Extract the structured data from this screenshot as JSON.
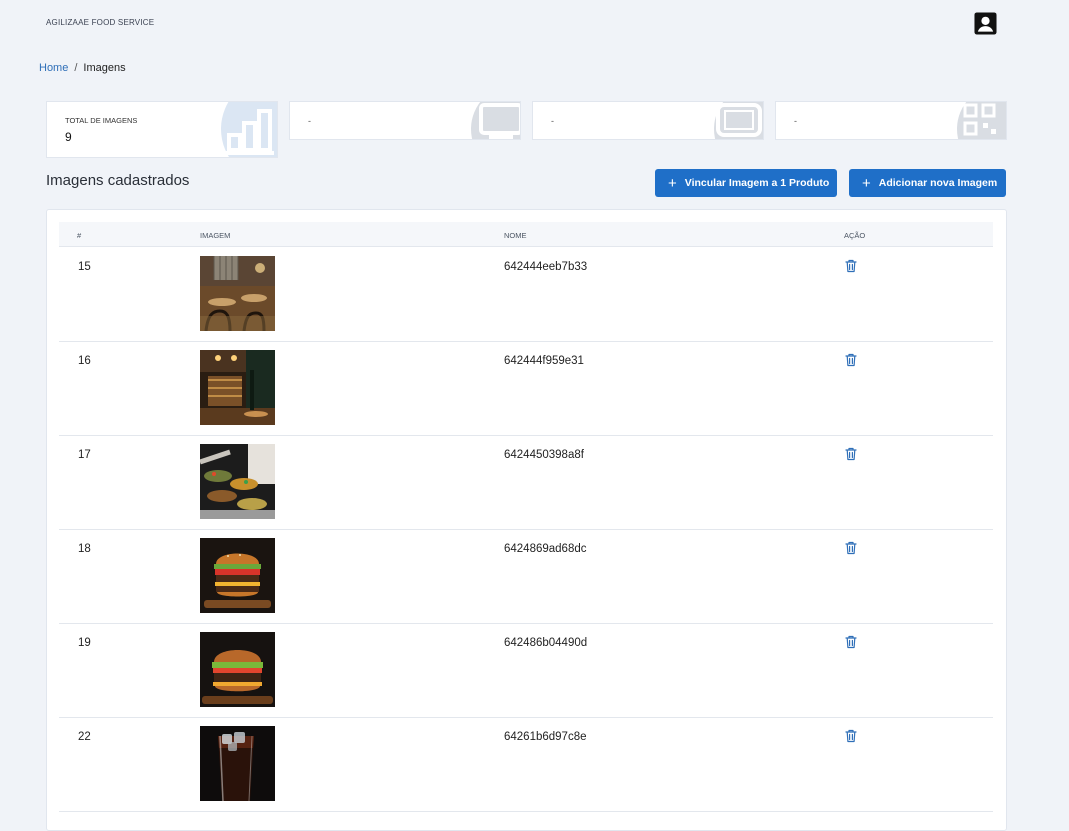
{
  "header": {
    "brand": "AGILIZAAE FOOD SERVICE",
    "user_icon": "user-square-icon"
  },
  "breadcrumb": {
    "home": "Home",
    "separator": "/",
    "current": "Imagens"
  },
  "stats": [
    {
      "label": "TOTAL DE IMAGENS",
      "value": "9",
      "icon": "chart-bars-icon"
    },
    {
      "label": "-",
      "icon": "monitor-icon"
    },
    {
      "label": "-",
      "icon": "tablet-icon"
    },
    {
      "label": "-",
      "icon": "qrcode-icon"
    }
  ],
  "section": {
    "title": "Imagens cadastrados"
  },
  "buttons": {
    "link_image": "Vincular Imagem a 1 Produto",
    "add_image": "Adicionar nova Imagem"
  },
  "table": {
    "headers": {
      "id": "#",
      "image": "IMAGEM",
      "name": "NOME",
      "action": "AÇÃO"
    },
    "rows": [
      {
        "id": "15",
        "name": "642444eeb7b33",
        "image_kind": "restaurant-interior"
      },
      {
        "id": "16",
        "name": "642444f959e31",
        "image_kind": "restaurant-bar"
      },
      {
        "id": "17",
        "name": "6424450398a8f",
        "image_kind": "food-buffet"
      },
      {
        "id": "18",
        "name": "6424869ad68dc",
        "image_kind": "burger"
      },
      {
        "id": "19",
        "name": "642486b04490d",
        "image_kind": "burger"
      },
      {
        "id": "22",
        "name": "64261b6d97c8e",
        "image_kind": "cola-glass"
      }
    ]
  },
  "colors": {
    "primary": "#1f6fc8",
    "background": "#f0f3f8",
    "link": "#2f6fb8",
    "icon_action": "#2f6fb8"
  }
}
